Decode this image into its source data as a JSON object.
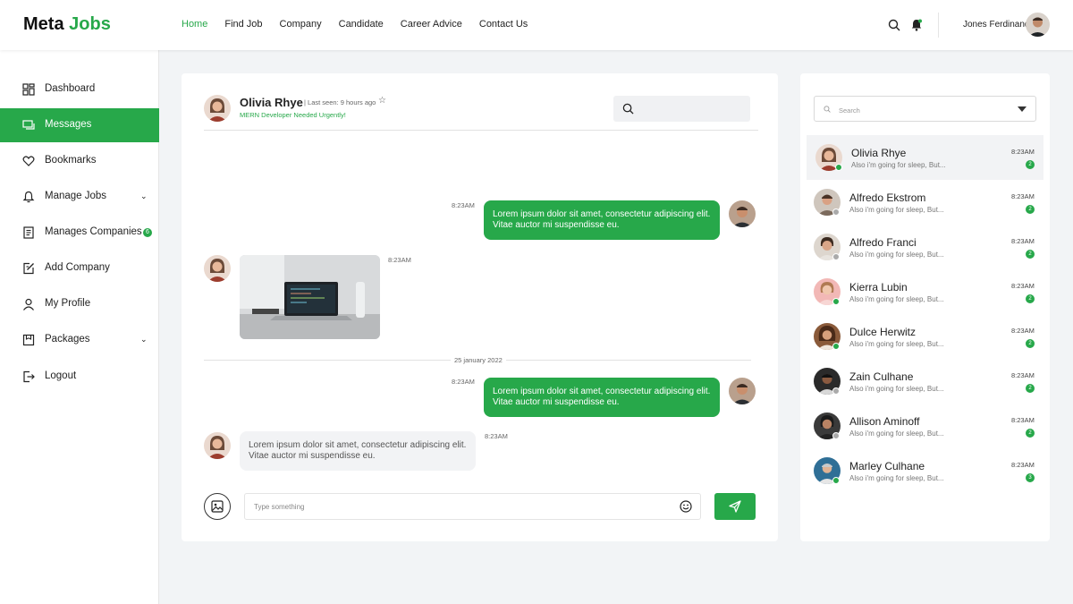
{
  "brand": {
    "part1": "Meta",
    "part2": "Jobs"
  },
  "nav": [
    {
      "label": "Home",
      "active": true
    },
    {
      "label": "Find Job",
      "active": false
    },
    {
      "label": "Company",
      "active": false
    },
    {
      "label": "Candidate",
      "active": false
    },
    {
      "label": "Career Advice",
      "active": false
    },
    {
      "label": "Contact Us",
      "active": false
    }
  ],
  "user": {
    "name": "Jones Ferdinand"
  },
  "sidebar": {
    "items": [
      {
        "label": "Dashboard",
        "icon": "dashboard-icon"
      },
      {
        "label": "Messages",
        "icon": "message-icon",
        "active": true
      },
      {
        "label": "Bookmarks",
        "icon": "heart-icon"
      },
      {
        "label": "Manage Jobs",
        "icon": "bell-icon",
        "expandable": true
      },
      {
        "label": "Manages Companies",
        "icon": "document-icon",
        "badge": "6"
      },
      {
        "label": "Add Company",
        "icon": "edit-icon"
      },
      {
        "label": "My Profile",
        "icon": "user-icon"
      },
      {
        "label": "Packages",
        "icon": "package-icon",
        "expandable": true
      },
      {
        "label": "Logout",
        "icon": "logout-icon"
      }
    ]
  },
  "chat": {
    "contact_name": "Olivia Rhye",
    "last_seen": "| Last seen: 9 hours ago",
    "subtitle": "MERN Developer Needed Urgently!",
    "messages": [
      {
        "time": "8:23AM",
        "text": "Lorem ipsum dolor sit amet, consectetur adipiscing elit. Vitae auctor mi suspendisse eu."
      },
      {
        "time": "8:23AM"
      },
      {
        "time": "8:23AM",
        "text": "Lorem ipsum dolor sit amet, consectetur adipiscing elit. Vitae auctor mi suspendisse eu."
      },
      {
        "time": "8:23AM",
        "text": "Lorem ipsum dolor sit amet, consectetur adipiscing elit. Vitae auctor mi suspendisse eu."
      }
    ],
    "date_divider": "25 january 2022",
    "input_placeholder": "Type something"
  },
  "contacts": {
    "search_placeholder": "Search",
    "items": [
      {
        "name": "Olivia Rhye",
        "preview": "Also i'm going for sleep, But...",
        "time": "8:23AM",
        "unread": "2",
        "online": true,
        "active": true
      },
      {
        "name": "Alfredo Ekstrom",
        "preview": "Also i'm going for sleep, But...",
        "time": "8:23AM",
        "unread": "2",
        "online": false
      },
      {
        "name": "Alfredo Franci",
        "preview": "Also i'm going for sleep, But...",
        "time": "8:23AM",
        "unread": "2",
        "online": false
      },
      {
        "name": "Kierra Lubin",
        "preview": "Also i'm going for sleep, But...",
        "time": "8:23AM",
        "unread": "2",
        "online": true
      },
      {
        "name": "Dulce Herwitz",
        "preview": "Also i'm going for sleep, But...",
        "time": "8:23AM",
        "unread": "2",
        "online": true
      },
      {
        "name": "Zain Culhane",
        "preview": "Also i'm going for sleep, But...",
        "time": "8:23AM",
        "unread": "2",
        "online": false
      },
      {
        "name": "Allison Aminoff",
        "preview": "Also i'm going for sleep, But...",
        "time": "8:23AM",
        "unread": "2",
        "online": false
      },
      {
        "name": "Marley Culhane",
        "preview": "Also i'm going for sleep, But...",
        "time": "8:23AM",
        "unread": "3",
        "online": true
      }
    ]
  },
  "colors": {
    "accent": "#27a84a"
  }
}
